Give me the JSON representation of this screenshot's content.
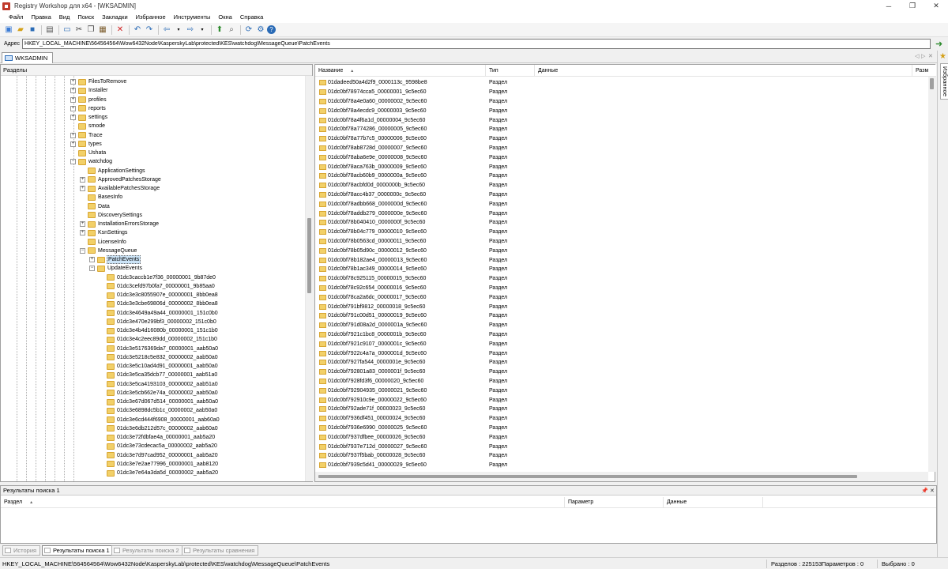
{
  "window": {
    "title": "Registry Workshop для x64 - [WKSADMIN]"
  },
  "menu": [
    "Файл",
    "Правка",
    "Вид",
    "Поиск",
    "Закладки",
    "Избранное",
    "Инструменты",
    "Окна",
    "Справка"
  ],
  "address": {
    "label": "Адрес",
    "value": "HKEY_LOCAL_MACHINE\\564564564\\Wow6432Node\\KasperskyLab\\protected\\KES\\watchdog\\MessageQueue\\PatchEvents"
  },
  "doc_tab": {
    "label": "WKSADMIN"
  },
  "favorites": {
    "label": "Избранное"
  },
  "tree": {
    "header": "Разделы",
    "items": [
      {
        "label": "FilesToRemove",
        "level": 0,
        "expander": "+"
      },
      {
        "label": "Installer",
        "level": 0,
        "expander": "+"
      },
      {
        "label": "profiles",
        "level": 0,
        "expander": "+"
      },
      {
        "label": "reports",
        "level": 0,
        "expander": "+"
      },
      {
        "label": "settings",
        "level": 0,
        "expander": "+"
      },
      {
        "label": "smode",
        "level": 0,
        "expander": ""
      },
      {
        "label": "Trace",
        "level": 0,
        "expander": "+"
      },
      {
        "label": "types",
        "level": 0,
        "expander": "+"
      },
      {
        "label": "Ushata",
        "level": 0,
        "expander": ""
      },
      {
        "label": "watchdog",
        "level": 0,
        "expander": "-"
      },
      {
        "label": "ApplicationSettings",
        "level": 1,
        "expander": ""
      },
      {
        "label": "ApprovedPatchesStorage",
        "level": 1,
        "expander": "+"
      },
      {
        "label": "AvailablePatchesStorage",
        "level": 1,
        "expander": "+"
      },
      {
        "label": "BasesInfo",
        "level": 1,
        "expander": ""
      },
      {
        "label": "Data",
        "level": 1,
        "expander": ""
      },
      {
        "label": "DiscoverySettings",
        "level": 1,
        "expander": ""
      },
      {
        "label": "InstallationErrorsStorage",
        "level": 1,
        "expander": "+"
      },
      {
        "label": "KsnSettings",
        "level": 1,
        "expander": "+"
      },
      {
        "label": "LicenseInfo",
        "level": 1,
        "expander": ""
      },
      {
        "label": "MessageQueue",
        "level": 1,
        "expander": "-"
      },
      {
        "label": "PatchEvents",
        "level": 2,
        "expander": "+",
        "selected": true
      },
      {
        "label": "UpdateEvents",
        "level": 2,
        "expander": "-"
      },
      {
        "label": "01dc3caccb1e7f36_00000001_9b87de0",
        "level": 3,
        "expander": ""
      },
      {
        "label": "01dc3cefd97b0fa7_00000001_9b85aa0",
        "level": 3,
        "expander": ""
      },
      {
        "label": "01dc3e3c8055907e_00000001_8bb0ea8",
        "level": 3,
        "expander": ""
      },
      {
        "label": "01dc3e3cbe69806d_00000002_8bb0ea8",
        "level": 3,
        "expander": ""
      },
      {
        "label": "01dc3e4649a49a44_00000001_151c0b0",
        "level": 3,
        "expander": ""
      },
      {
        "label": "01dc3e470e299bf3_00000002_151c0b0",
        "level": 3,
        "expander": ""
      },
      {
        "label": "01dc3e4b4d16080b_00000001_151c1b0",
        "level": 3,
        "expander": ""
      },
      {
        "label": "01dc3e4c2eec89dd_00000002_151c1b0",
        "level": 3,
        "expander": ""
      },
      {
        "label": "01dc3e5176369da7_00000001_aab50a0",
        "level": 3,
        "expander": ""
      },
      {
        "label": "01dc3e5218c5e832_00000002_aab50a0",
        "level": 3,
        "expander": ""
      },
      {
        "label": "01dc3e5c10ad4d91_00000001_aab50a0",
        "level": 3,
        "expander": ""
      },
      {
        "label": "01dc3e5ca35dcb77_00000001_aab51a0",
        "level": 3,
        "expander": ""
      },
      {
        "label": "01dc3e5ca4193103_00000002_aab51a0",
        "level": 3,
        "expander": ""
      },
      {
        "label": "01dc3e5cb662e74a_00000002_aab50a0",
        "level": 3,
        "expander": ""
      },
      {
        "label": "01dc3e67d067d514_00000001_aab50a0",
        "level": 3,
        "expander": ""
      },
      {
        "label": "01dc3e6898dc5b1c_00000002_aab50a0",
        "level": 3,
        "expander": ""
      },
      {
        "label": "01dc3e6cd444f6908_00000001_aab60a0",
        "level": 3,
        "expander": ""
      },
      {
        "label": "01dc3e6db212d57c_00000002_aab60a0",
        "level": 3,
        "expander": ""
      },
      {
        "label": "01dc3e72fdbfae4a_00000001_aab5a20",
        "level": 3,
        "expander": ""
      },
      {
        "label": "01dc3e73cdecac5a_00000002_aab5a20",
        "level": 3,
        "expander": ""
      },
      {
        "label": "01dc3e7d97cad952_00000001_aab5a20",
        "level": 3,
        "expander": ""
      },
      {
        "label": "01dc3e7e2ae77996_00000001_aab8120",
        "level": 3,
        "expander": ""
      },
      {
        "label": "01dc3e7e64a3da5d_00000002_aab5a20",
        "level": 3,
        "expander": ""
      }
    ]
  },
  "list": {
    "columns": {
      "name": "Название",
      "type": "Тип",
      "data": "Данные",
      "size": "Разм"
    },
    "rows": [
      {
        "name": "01dadeed50a4d2f9_0000113c_9598be8",
        "type": "Раздел"
      },
      {
        "name": "01dc0bf78974cca5_00000001_9c5ec60",
        "type": "Раздел"
      },
      {
        "name": "01dc0bf78a4e0a60_00000002_9c5ec60",
        "type": "Раздел"
      },
      {
        "name": "01dc0bf78a4ecdc9_00000003_9c5ec60",
        "type": "Раздел"
      },
      {
        "name": "01dc0bf78a4f6a1d_00000004_9c5ec60",
        "type": "Раздел"
      },
      {
        "name": "01dc0bf78a774286_00000005_9c5ec60",
        "type": "Раздел"
      },
      {
        "name": "01dc0bf78a77b7c5_00000006_9c5ec60",
        "type": "Раздел"
      },
      {
        "name": "01dc0bf78ab8728d_00000007_9c5ec60",
        "type": "Раздел"
      },
      {
        "name": "01dc0bf78aba6e9e_00000008_9c5ec60",
        "type": "Раздел"
      },
      {
        "name": "01dc0bf78aca763b_00000009_9c5ec60",
        "type": "Раздел"
      },
      {
        "name": "01dc0bf78acb60b9_0000000a_9c5ec60",
        "type": "Раздел"
      },
      {
        "name": "01dc0bf78acbfd0d_0000000b_9c5ec60",
        "type": "Раздел"
      },
      {
        "name": "01dc0bf78acc4b37_0000000c_9c5ec60",
        "type": "Раздел"
      },
      {
        "name": "01dc0bf78adbb668_0000000d_9c5ec60",
        "type": "Раздел"
      },
      {
        "name": "01dc0bf78addb279_0000000e_9c5ec60",
        "type": "Раздел"
      },
      {
        "name": "01dc0bf78b040410_0000000f_9c5ec60",
        "type": "Раздел"
      },
      {
        "name": "01dc0bf78b04c779_00000010_9c5ec60",
        "type": "Раздел"
      },
      {
        "name": "01dc0bf78b0563cd_00000011_9c5ec60",
        "type": "Раздел"
      },
      {
        "name": "01dc0bf78b05d90c_00000012_9c5ec60",
        "type": "Раздел"
      },
      {
        "name": "01dc0bf78b182ae4_00000013_9c5ec60",
        "type": "Раздел"
      },
      {
        "name": "01dc0bf78b1ac349_00000014_9c5ec60",
        "type": "Раздел"
      },
      {
        "name": "01dc0bf78c925115_00000015_9c5ec60",
        "type": "Раздел"
      },
      {
        "name": "01dc0bf78c92c654_00000016_9c5ec60",
        "type": "Раздел"
      },
      {
        "name": "01dc0bf78ca2a6dc_00000017_9c5ec60",
        "type": "Раздел"
      },
      {
        "name": "01dc0bf791bf9812_00000018_9c5ec60",
        "type": "Раздел"
      },
      {
        "name": "01dc0bf791c00d51_00000019_9c5ec60",
        "type": "Раздел"
      },
      {
        "name": "01dc0bf791d08a2d_0000001a_9c5ec60",
        "type": "Раздел"
      },
      {
        "name": "01dc0bf7921c1bc8_0000001b_9c5ec60",
        "type": "Раздел"
      },
      {
        "name": "01dc0bf7921c9107_0000001c_9c5ec60",
        "type": "Раздел"
      },
      {
        "name": "01dc0bf7922c4a7a_0000001d_9c5ec60",
        "type": "Раздел"
      },
      {
        "name": "01dc0bf7927fa544_0000001e_9c5ec60",
        "type": "Раздел"
      },
      {
        "name": "01dc0bf792801a83_0000001f_9c5ec60",
        "type": "Раздел"
      },
      {
        "name": "01dc0bf7928fd3f6_00000020_9c5ec60",
        "type": "Раздел"
      },
      {
        "name": "01dc0bf792904935_00000021_9c5ec60",
        "type": "Раздел"
      },
      {
        "name": "01dc0bf792910c9e_00000022_9c5ec60",
        "type": "Раздел"
      },
      {
        "name": "01dc0bf792ade71f_00000023_9c5ec60",
        "type": "Раздел"
      },
      {
        "name": "01dc0bf7936df451_00000024_9c5ec60",
        "type": "Раздел"
      },
      {
        "name": "01dc0bf7936e6990_00000025_9c5ec60",
        "type": "Раздел"
      },
      {
        "name": "01dc0bf7937dfbee_00000026_9c5ec60",
        "type": "Раздел"
      },
      {
        "name": "01dc0bf7937e712d_00000027_9c5ec60",
        "type": "Раздел"
      },
      {
        "name": "01dc0bf7937f5bab_00000028_9c5ec60",
        "type": "Раздел"
      },
      {
        "name": "01dc0bf7939c5d41_00000029_9c5ec60",
        "type": "Раздел"
      }
    ]
  },
  "search": {
    "title": "Результаты поиска 1",
    "columns": {
      "section": "Раздел",
      "param": "Параметр",
      "data": "Данные"
    }
  },
  "bottom_tabs": [
    {
      "label": "История",
      "active": false
    },
    {
      "label": "Результаты поиска 1",
      "active": true
    },
    {
      "label": "Результаты поиска 2",
      "active": false
    },
    {
      "label": "Результаты сравнения",
      "active": false
    }
  ],
  "status": {
    "path": "HKEY_LOCAL_MACHINE\\564564564\\Wow6432Node\\KasperskyLab\\protected\\KES\\watchdog\\MessageQueue\\PatchEvents",
    "sections": "Разделов : 225153",
    "params": "Параметров : 0",
    "selected": "Выбрано : 0"
  },
  "icons": [
    "app-icon",
    "new-icon",
    "open-icon",
    "save-icon",
    "print-icon",
    "computer-icon",
    "cut-icon",
    "copy-icon",
    "paste-icon",
    "delete-icon",
    "undo-icon",
    "redo-icon",
    "back-icon",
    "forward-icon",
    "export-icon",
    "find-icon",
    "refresh-icon",
    "options-icon",
    "help-icon",
    "go-arrow-icon",
    "favorites-star-icon"
  ]
}
